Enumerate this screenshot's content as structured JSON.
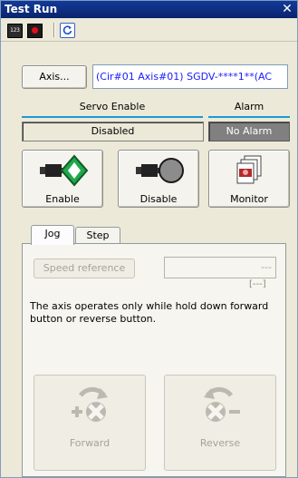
{
  "window": {
    "title": "Test Run",
    "close_glyph": "✕"
  },
  "toolbar": {
    "icons": [
      "counter-123-icon",
      "record-stop-icon",
      "refresh-icon"
    ],
    "counter_glyph": "123"
  },
  "axis": {
    "button_label": "Axis...",
    "value": "(Cir#01 Axis#01) SGDV-****1**(AC"
  },
  "status": {
    "servo_enable_label": "Servo Enable",
    "servo_enable_value": "Disabled",
    "alarm_label": "Alarm",
    "alarm_value": "No Alarm"
  },
  "actions": {
    "enable_label": "Enable",
    "disable_label": "Disable",
    "monitor_label": "Monitor"
  },
  "tabs": [
    {
      "label": "Jog",
      "active": true
    },
    {
      "label": "Step",
      "active": false
    }
  ],
  "jog": {
    "speed_button_label": "Speed reference",
    "speed_value": "---",
    "speed_unit": "[---]",
    "note": "The axis operates only while hold down forward button or reverse button.",
    "forward_label": "Forward",
    "reverse_label": "Reverse"
  },
  "colors": {
    "titlebar": "#0a246a",
    "enable_green": "#1fa84a",
    "alarm_bg": "#808080",
    "axis_text": "#1a1aff"
  }
}
